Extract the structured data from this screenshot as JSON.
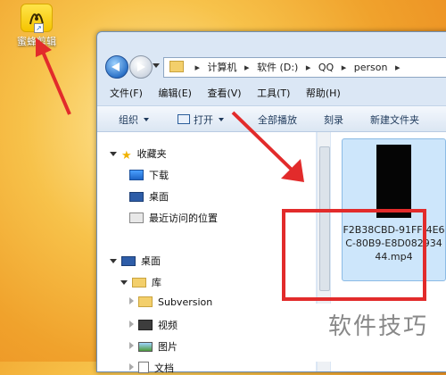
{
  "desktop": {
    "shortcut_label": "蜜蜂剪辑"
  },
  "address": {
    "crumbs": [
      "计算机",
      "软件 (D:)",
      "QQ",
      "person"
    ]
  },
  "menu": [
    "文件(F)",
    "编辑(E)",
    "查看(V)",
    "工具(T)",
    "帮助(H)"
  ],
  "toolbar": {
    "organize": "组织",
    "open": "打开",
    "play_all": "全部播放",
    "burn": "刻录",
    "new_folder": "新建文件夹"
  },
  "nav": {
    "favorites": "收藏夹",
    "downloads": "下载",
    "desktop": "桌面",
    "recent": "最近访问的位置",
    "desktop_root": "桌面",
    "libraries": "库",
    "subversion": "Subversion",
    "videos": "视频",
    "pictures": "图片",
    "documents": "文档"
  },
  "file": {
    "name": "F2B38CBD-91FF-4E6C-80B9-E8D08293444.mp4"
  },
  "watermark": "软件技巧",
  "colors": {
    "highlight": "#e22b2b",
    "selection": "#cde6fb"
  }
}
